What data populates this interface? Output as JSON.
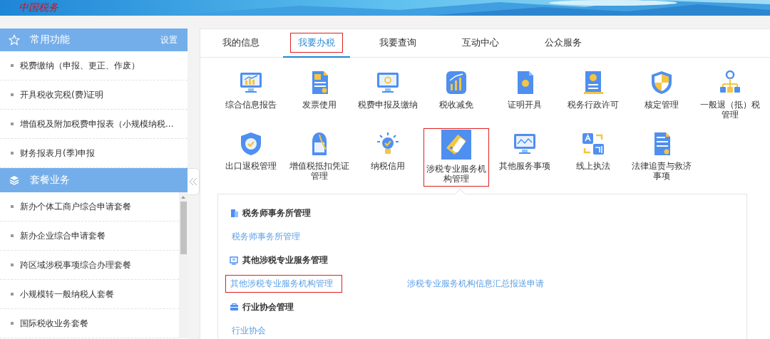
{
  "header": {
    "logo": "中国税务"
  },
  "sidebar": {
    "sections": [
      {
        "title": "常用功能",
        "action": "设置",
        "scrollable": false,
        "items": [
          "税费缴纳（申报、更正、作废）",
          "开具税收完税(费)证明",
          "增值税及附加税费申报表（小规模纳税...",
          "财务报表月(季)申报"
        ]
      },
      {
        "title": "套餐业务",
        "scrollable": true,
        "items": [
          "新办个体工商户综合申请套餐",
          "新办企业综合申请套餐",
          "跨区域涉税事项综合办理套餐",
          "小规模转一般纳税人套餐",
          "国际税收业务套餐"
        ]
      }
    ]
  },
  "tabs": [
    {
      "label": "我的信息",
      "selected": false,
      "highlighted": false
    },
    {
      "label": "我要办税",
      "selected": true,
      "highlighted": true
    },
    {
      "label": "我要查询",
      "selected": false,
      "highlighted": false
    },
    {
      "label": "互动中心",
      "selected": false,
      "highlighted": false
    },
    {
      "label": "公众服务",
      "selected": false,
      "highlighted": false
    }
  ],
  "services": [
    {
      "label": "综合信息报告",
      "selected": false,
      "highlighted": false
    },
    {
      "label": "发票使用",
      "selected": false,
      "highlighted": false
    },
    {
      "label": "税费申报及缴纳",
      "selected": false,
      "highlighted": false
    },
    {
      "label": "税收减免",
      "selected": false,
      "highlighted": false
    },
    {
      "label": "证明开具",
      "selected": false,
      "highlighted": false
    },
    {
      "label": "税务行政许可",
      "selected": false,
      "highlighted": false
    },
    {
      "label": "核定管理",
      "selected": false,
      "highlighted": false
    },
    {
      "label": "一般退（抵）税管理",
      "selected": false,
      "highlighted": false
    },
    {
      "label": "出口退税管理",
      "selected": false,
      "highlighted": false
    },
    {
      "label": "增值税抵扣凭证管理",
      "selected": false,
      "highlighted": false
    },
    {
      "label": "纳税信用",
      "selected": false,
      "highlighted": false
    },
    {
      "label": "涉税专业服务机构管理",
      "selected": true,
      "highlighted": true
    },
    {
      "label": "其他服务事项",
      "selected": false,
      "highlighted": false
    },
    {
      "label": "线上执法",
      "selected": false,
      "highlighted": false
    },
    {
      "label": "法律追责与救济事项",
      "selected": false,
      "highlighted": false
    }
  ],
  "submenu": {
    "groups": [
      {
        "title": "税务师事务所管理",
        "links": [
          {
            "label": "税务师事务所管理",
            "highlighted": false
          }
        ]
      },
      {
        "title": "其他涉税专业服务管理",
        "links": [
          {
            "label": "其他涉税专业服务机构管理",
            "highlighted": true
          },
          {
            "label": "涉税专业服务机构信息汇总报送申请",
            "highlighted": false
          }
        ]
      },
      {
        "title": "行业协会管理",
        "links": [
          {
            "label": "行业协会",
            "highlighted": false
          }
        ]
      }
    ]
  }
}
